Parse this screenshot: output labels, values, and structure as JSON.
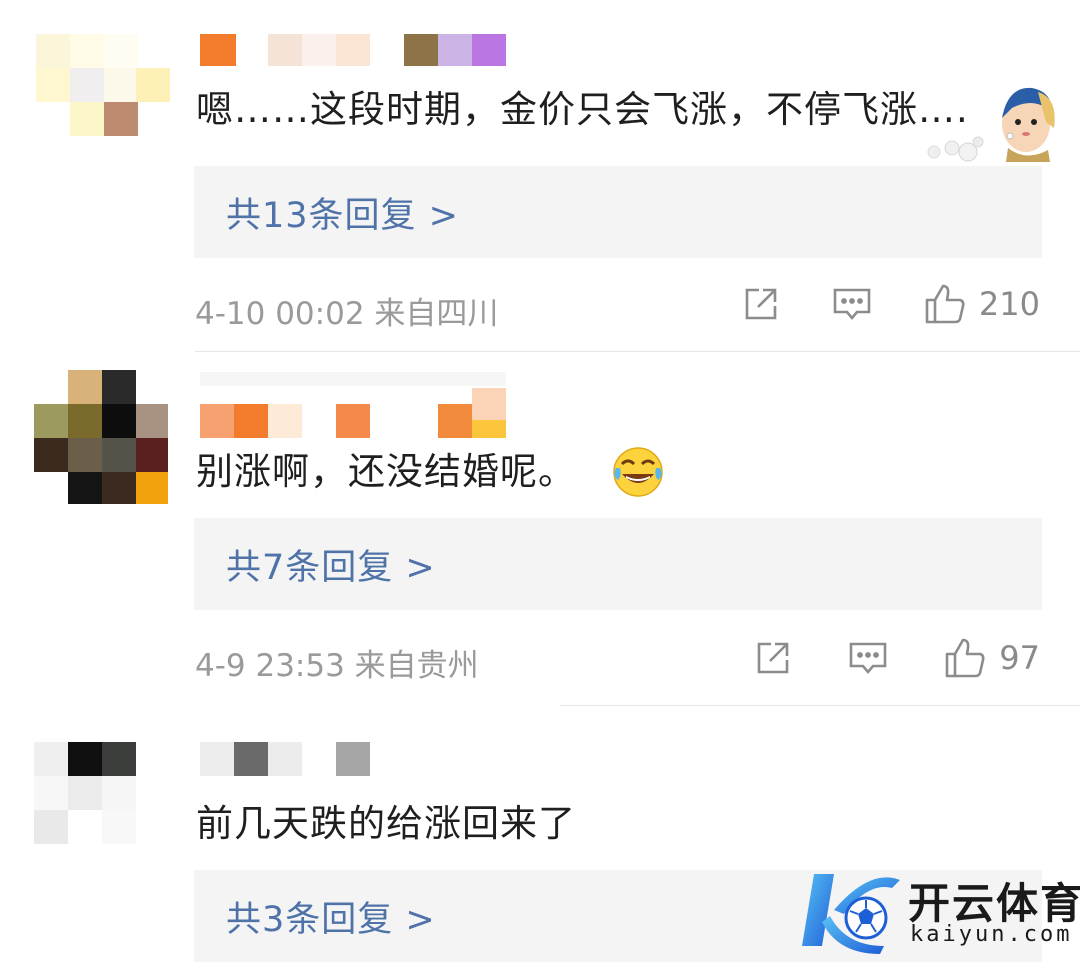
{
  "comments": [
    {
      "text": "嗯……这段时期，金价只会飞涨，不停飞涨….",
      "replies_label": "共13条回复 >",
      "meta": "4-10 00:02 来自四川",
      "likes": "210",
      "sticker": "girl-with-pearl-earring-sticker"
    },
    {
      "text": "别涨啊，还没结婚呢。",
      "replies_label": "共7条回复 >",
      "meta": "4-9 23:53 来自贵州",
      "likes": "97",
      "emoji": "laugh-cry-emoji"
    },
    {
      "text": "前几天跌的给涨回来了",
      "replies_label": "共3条回复 >"
    }
  ],
  "icons": {
    "share": "share-icon",
    "comment": "comment-icon",
    "like": "thumbs-up-icon"
  },
  "watermark": {
    "title": "开云体育",
    "subtitle": "kaiyun.com",
    "logo": "k-football-logo"
  },
  "colors": {
    "reply_link": "#4f73a8",
    "reply_bg": "#f4f4f4",
    "meta": "#9a9a9a",
    "logo_blue": "#2a6fdb"
  }
}
